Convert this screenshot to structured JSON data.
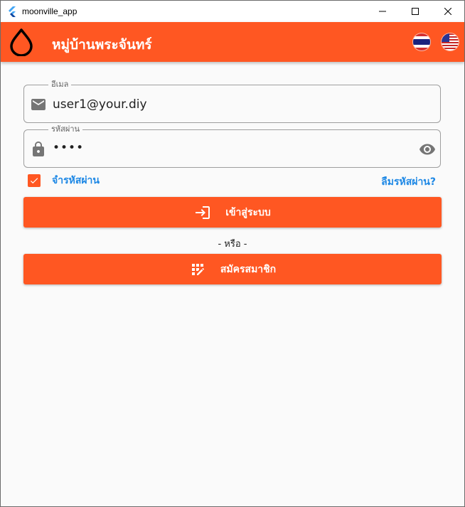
{
  "window": {
    "title": "moonville_app",
    "flutter_logo_icon": "flutter-logo-icon"
  },
  "appbar": {
    "title": "หมู่บ้านพระจันทร์",
    "logo_icon": "water-drop-icon",
    "languages": [
      "th-flag",
      "us-flag"
    ],
    "color": "#ff5722"
  },
  "form": {
    "email": {
      "label": "อีเมล",
      "value": "user1@your.diy",
      "icon": "mail-icon"
    },
    "password": {
      "label": "รหัสผ่าน",
      "value": "••••",
      "icon": "lock-icon",
      "toggle_icon": "eye-icon"
    },
    "remember": {
      "label": "จำรหัสผ่าน",
      "checked": true
    },
    "forgot_label": "ลืมรหัสผ่าน?",
    "login_label": "เข้าสู่ระบบ",
    "or_label": "- หรือ -",
    "register_label": "สมัครสมาชิก"
  },
  "colors": {
    "accent": "#ff5722",
    "link": "#1e88e5"
  }
}
